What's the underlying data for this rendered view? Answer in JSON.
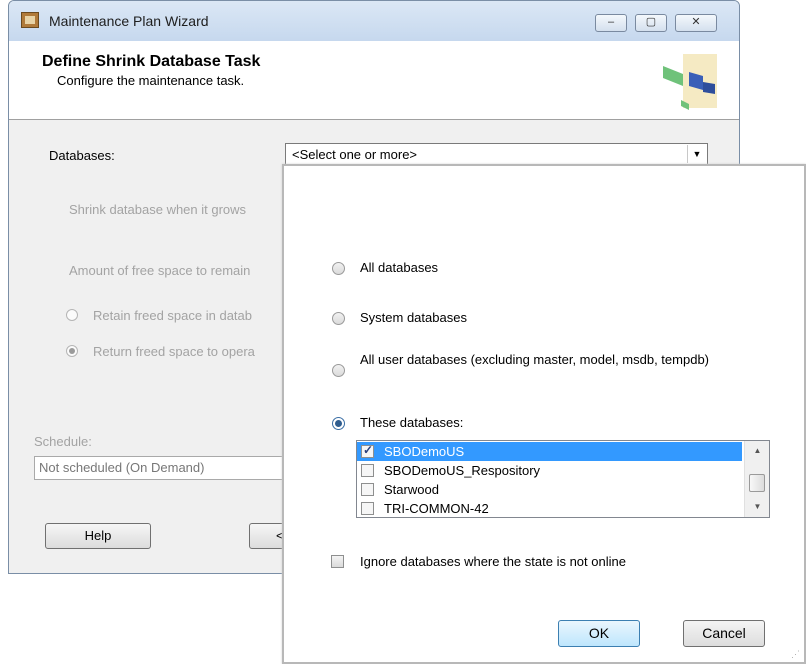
{
  "window": {
    "title": "Maintenance Plan Wizard",
    "minimize": "–",
    "maximize": "▢",
    "close": "✕"
  },
  "header": {
    "title": "Define Shrink Database Task",
    "subtitle": "Configure the maintenance task."
  },
  "form": {
    "databases_label": "Databases:",
    "databases_value": "<Select one or more>",
    "shrink_label": "Shrink database when it grows",
    "free_space_label": "Amount of free space to remain",
    "retain_label": "Retain freed space in datab",
    "return_label": "Return freed space to opera",
    "schedule_label": "Schedule:",
    "schedule_value": "Not scheduled (On Demand)"
  },
  "footer": {
    "help_label": "Help",
    "back_label": "<"
  },
  "popup": {
    "options": {
      "all": "All databases",
      "system": "System databases",
      "user": "All user databases  (excluding master, model, msdb, tempdb)",
      "these": "These databases:"
    },
    "selected_option": "these",
    "list": [
      {
        "name": "SBODemoUS",
        "checked": true,
        "selected": true
      },
      {
        "name": "SBODemoUS_Respository",
        "checked": false,
        "selected": false
      },
      {
        "name": "Starwood",
        "checked": false,
        "selected": false
      },
      {
        "name": "TRI-COMMON-42",
        "checked": false,
        "selected": false
      }
    ],
    "ignore_label": "Ignore databases where the state is not online",
    "ok_label": "OK",
    "cancel_label": "Cancel"
  }
}
